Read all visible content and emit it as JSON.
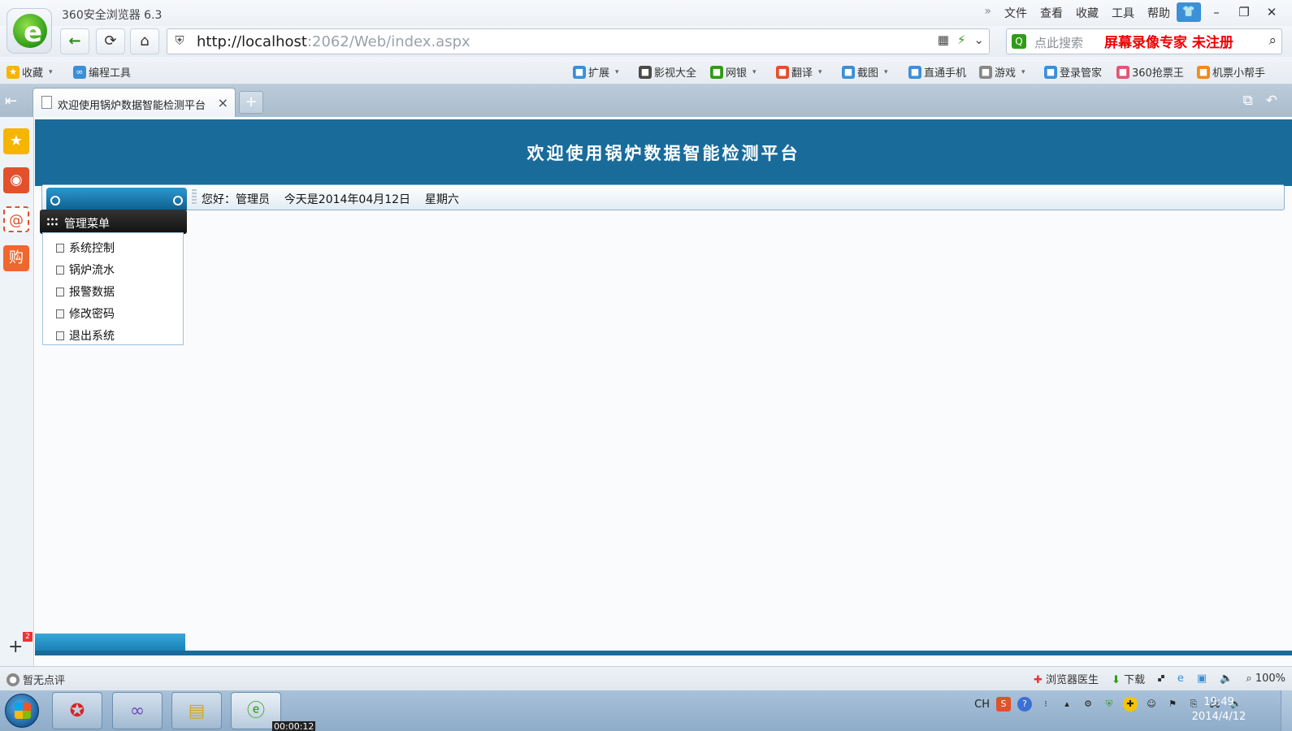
{
  "browser": {
    "title": "360安全浏览器 6.3",
    "menu": [
      "»",
      "文件",
      "查看",
      "收藏",
      "工具",
      "帮助"
    ],
    "address": {
      "host": "http://localhost",
      "rest": ":2062/Web/index.aspx"
    },
    "search_placeholder": "点此搜索",
    "recorder_watermark": "屏幕录像专家  未注册"
  },
  "favorites": {
    "left": [
      {
        "label": "收藏",
        "icon": "star-icon",
        "color": "#f6b500"
      },
      {
        "label": "编程工具",
        "icon": "folder-icon",
        "color": "#3d8fd6"
      }
    ],
    "right": [
      {
        "label": "扩展",
        "icon": "extensions-icon",
        "color": "#3d8fd6",
        "caret": true
      },
      {
        "label": "影视大全",
        "icon": "video-icon",
        "color": "#4a4a4a",
        "caret": false
      },
      {
        "label": "网银",
        "icon": "bank-icon",
        "color": "#2f9b16",
        "caret": true
      },
      {
        "label": "翻译",
        "icon": "translate-icon",
        "color": "#e2502c",
        "caret": true
      },
      {
        "label": "截图",
        "icon": "screenshot-icon",
        "color": "#3d8fd6",
        "caret": true
      },
      {
        "label": "直通手机",
        "icon": "phone-icon",
        "color": "#3d8fd6",
        "caret": false
      },
      {
        "label": "游戏",
        "icon": "game-icon",
        "color": "#888888",
        "caret": true
      },
      {
        "label": "登录管家",
        "icon": "key-icon",
        "color": "#3d8fd6",
        "caret": false
      },
      {
        "label": "360抢票王",
        "icon": "ticket-icon",
        "color": "#e25575",
        "caret": false
      },
      {
        "label": "机票小帮手",
        "icon": "plane-icon",
        "color": "#f08a1c",
        "caret": false
      }
    ]
  },
  "tab": {
    "title": "欢迎使用锅炉数据智能检测平台",
    "close": "×",
    "new": "+"
  },
  "page": {
    "banner_title": "欢迎使用锅炉数据智能检测平台",
    "greeting": "您好：管理员    今天是2014年04月12日    星期六",
    "menu_title": "管理菜单",
    "menu_items": [
      "系统控制",
      "锅炉流水",
      "报警数据",
      "修改密码",
      "退出系统"
    ]
  },
  "sidebar": {
    "add_badge": "2"
  },
  "status": {
    "left": "暂无点评",
    "doctor": "浏览器医生",
    "download": "下载",
    "zoom": "100%"
  },
  "taskbar": {
    "record_time": "00:00:12",
    "tray_lang": "CH",
    "time": "19:49",
    "date": "2014/4/12"
  }
}
